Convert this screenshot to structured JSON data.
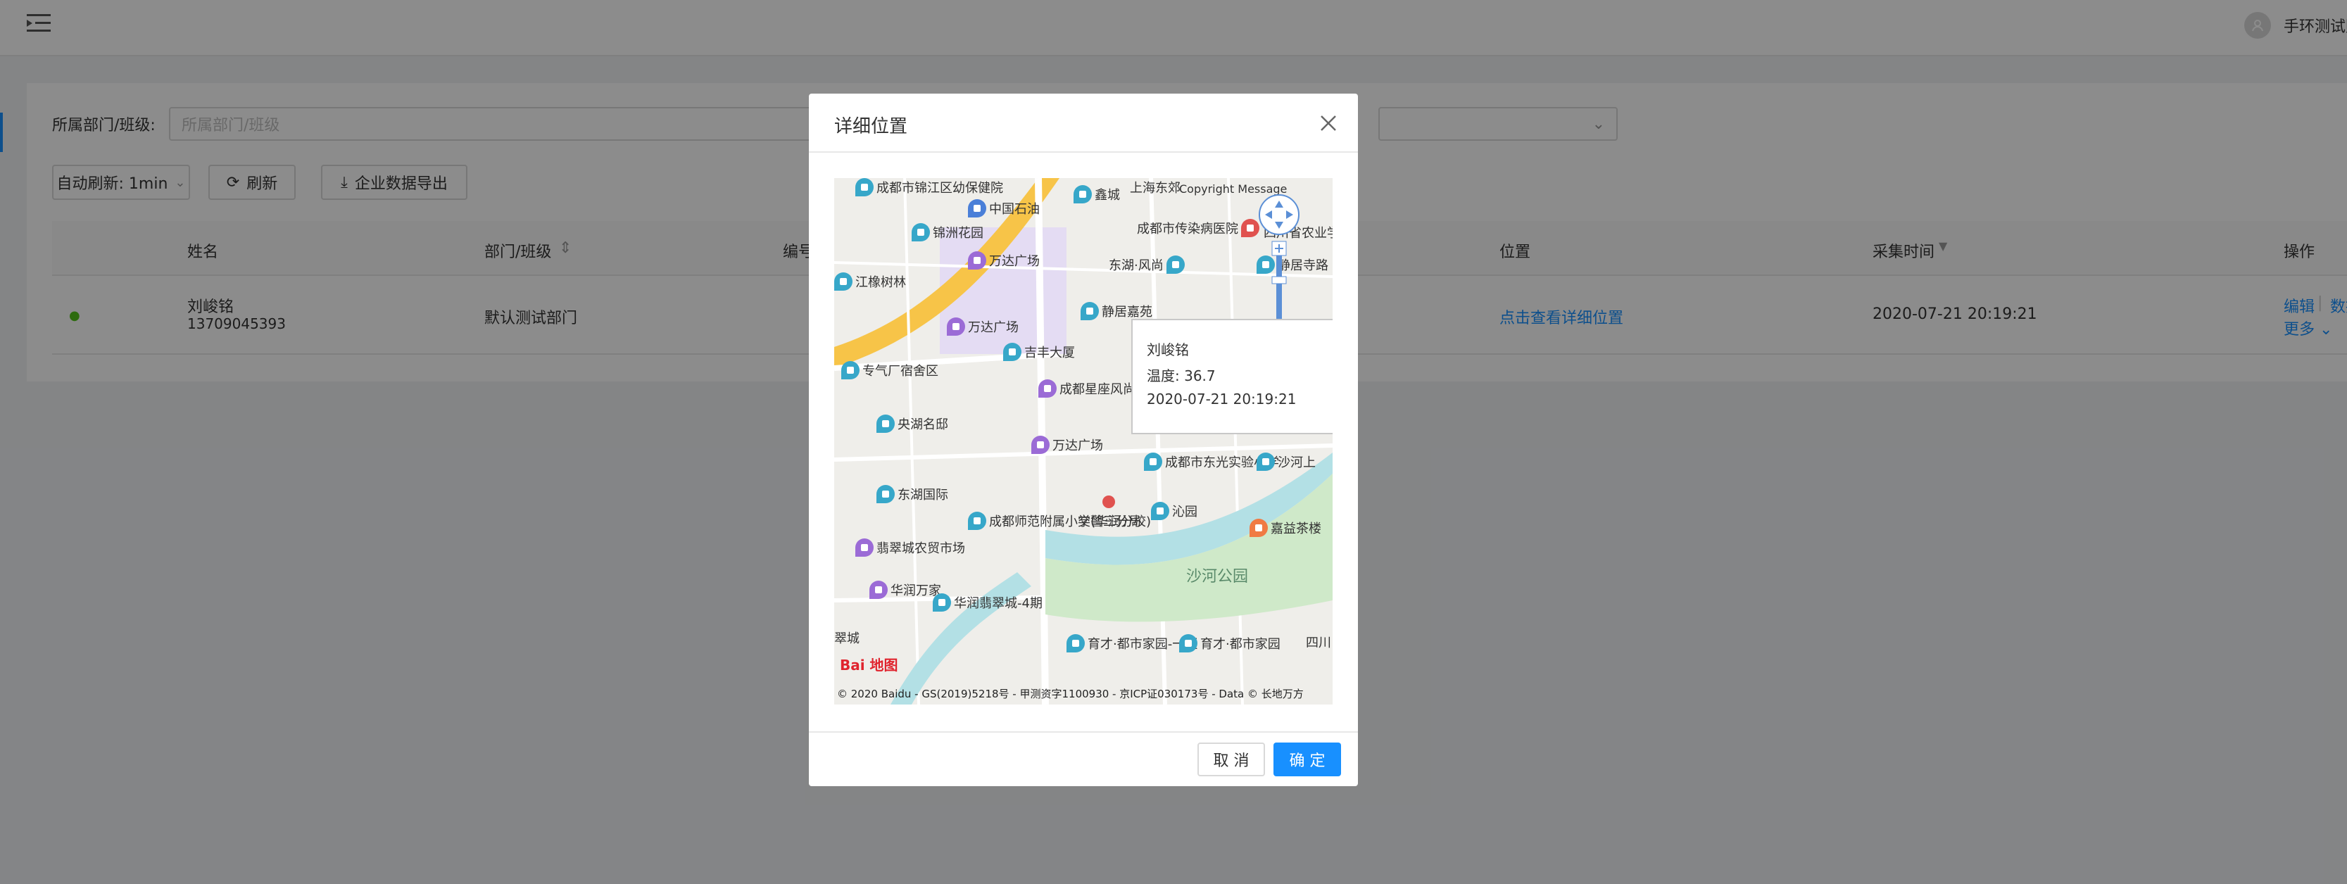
{
  "header": {
    "user_name": "手环测试账号"
  },
  "filters": {
    "dept_label": "所属部门/班级:",
    "dept_placeholder": "所属部门/班级"
  },
  "toolbar": {
    "auto_refresh": "自动刷新: 1min",
    "refresh": "刷新",
    "export": "企业数据导出"
  },
  "table": {
    "columns": {
      "name": "姓名",
      "dept": "部门/班级",
      "number": "编号",
      "location": "位置",
      "time": "采集时间",
      "actions": "操作"
    },
    "rows": [
      {
        "name": "刘峻铭",
        "phone": "13709045393",
        "dept": "默认测试部门",
        "location": "点击查看详细位置",
        "time": "2020-07-21 20:19:21",
        "edit": "编辑",
        "data": "数据",
        "more": "更多"
      }
    ]
  },
  "modal": {
    "title": "详细位置",
    "cancel": "取 消",
    "ok": "确 定",
    "popup": {
      "name": "刘峻铭",
      "temp": "温度: 36.7",
      "time": "2020-07-21 20:19:21"
    },
    "map": {
      "copyright_top": "Copyright Message",
      "copyright_bottom": "© 2020 Baidu - GS(2019)5218号 - 甲测资字1100930 - 京ICP证030173号 - Data © 长地万方",
      "logo": "Bai 地图",
      "labels": [
        {
          "text": "成都市锦江区幼保健院",
          "color": "teal"
        },
        {
          "text": "中国石油",
          "color": "blue"
        },
        {
          "text": "锦洲花园",
          "color": "teal"
        },
        {
          "text": "万达广场",
          "color": "purple"
        },
        {
          "text": "江橡树林",
          "color": "teal"
        },
        {
          "text": "万达广场",
          "color": "purple"
        },
        {
          "text": "吉丰大厦",
          "color": "teal"
        },
        {
          "text": "专气厂宿舍区",
          "color": "teal"
        },
        {
          "text": "成都星座风尚视觉概念酒店",
          "color": "purple"
        },
        {
          "text": "央湖名邸",
          "color": "teal"
        },
        {
          "text": "万达广场",
          "color": "purple"
        },
        {
          "text": "东湖国际",
          "color": "teal"
        },
        {
          "text": "成都师范附属小学(华润分校)",
          "color": "teal"
        },
        {
          "text": "交警三分局",
          "color": "red"
        },
        {
          "text": "沁园",
          "color": "teal"
        },
        {
          "text": "翡翠城农贸市场",
          "color": "purple"
        },
        {
          "text": "华润万家",
          "color": "purple"
        },
        {
          "text": "华润翡翠城-4期",
          "color": "teal"
        },
        {
          "text": "育才·都市家园-一区",
          "color": "teal"
        },
        {
          "text": "育才·都市家园",
          "color": "teal"
        },
        {
          "text": "成都市东光实验小学",
          "color": "teal"
        },
        {
          "text": "沙河上",
          "color": "teal"
        },
        {
          "text": "嘉益茶楼",
          "color": "orange"
        },
        {
          "text": "上海东郊",
          "color": "teal"
        },
        {
          "text": "鑫城",
          "color": "teal"
        },
        {
          "text": "成都市传染病医院",
          "color": "red"
        },
        {
          "text": "东湖·风尚",
          "color": "teal"
        },
        {
          "text": "静居嘉苑",
          "color": "teal"
        },
        {
          "text": "四川省农业学院",
          "color": "teal"
        },
        {
          "text": "静居寺路",
          "color": "teal"
        },
        {
          "text": "翠城",
          "color": "teal"
        },
        {
          "text": "四川",
          "color": "teal"
        }
      ],
      "area_labels": [
        "沙河公园"
      ]
    }
  }
}
